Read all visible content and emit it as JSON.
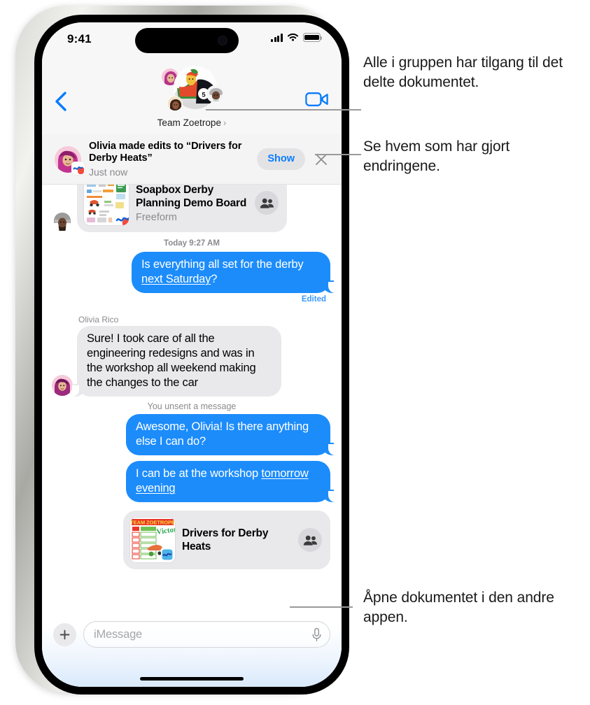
{
  "phone": {
    "status_bar": {
      "time": "9:41",
      "cellular_icon": "cellular-signal-icon",
      "wifi_icon": "wifi-icon",
      "battery_icon": "battery-icon"
    },
    "nav_bar": {
      "back_icon": "back-chevron-icon",
      "facetime_icon": "facetime-video-icon",
      "group_name": "Team Zoetrope",
      "group_caret": "›"
    },
    "notification": {
      "title": "Olivia made edits to “Drivers for Derby Heats”",
      "timestamp": "Just now",
      "show_label": "Show",
      "close_icon": "close-x-icon",
      "app_badge_icon": "freeform-app-icon"
    },
    "conversation": {
      "items": [
        {
          "kind": "link_card",
          "side": "in",
          "title": "Soapbox Derby Planning Demo Board",
          "subtitle": "Freeform",
          "people_icon": "people-collaboration-icon"
        },
        {
          "kind": "timestamp",
          "text": "Today 9:27 AM"
        },
        {
          "kind": "bubble",
          "side": "out",
          "text_before": "Is everything all set for the derby ",
          "text_link": "next Saturday",
          "text_after": "?",
          "edited_label": "Edited"
        },
        {
          "kind": "sender",
          "text": "Olivia Rico"
        },
        {
          "kind": "bubble",
          "side": "in",
          "text": "Sure! I took care of all the engineering redesigns and was in the workshop all weekend making the changes to the car"
        },
        {
          "kind": "system",
          "text": "You unsent a message"
        },
        {
          "kind": "bubble",
          "side": "out",
          "text": "Awesome, Olivia! Is there anything else I can do?"
        },
        {
          "kind": "bubble",
          "side": "out",
          "text_before": "I can be at the workshop ",
          "text_link": "tomorrow evening",
          "text_after": ""
        },
        {
          "kind": "link_card",
          "side": "out",
          "title": "Drivers for Derby Heats",
          "people_icon": "people-collaboration-icon"
        }
      ]
    },
    "input_bar": {
      "plus_icon": "plus-icon",
      "placeholder": "iMessage",
      "mic_icon": "microphone-icon"
    }
  },
  "callouts": [
    {
      "text": "Alle i gruppen har tilgang til det delte dokumentet."
    },
    {
      "text": "Se hvem som har gjort endringene."
    },
    {
      "text": "Åpne dokumentet i den andre appen."
    }
  ],
  "colors": {
    "imessage_blue": "#1c8cfb",
    "bubble_gray": "#e9e9eb",
    "accent_link": "#0a7cff",
    "secondary_text": "#8a8a8e"
  }
}
